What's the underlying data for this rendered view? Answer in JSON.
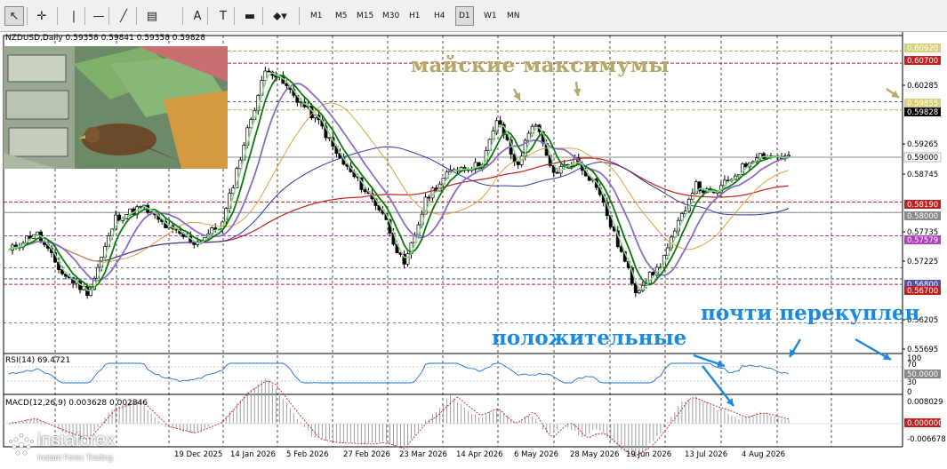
{
  "toolbar": {
    "tools": [
      {
        "name": "cursor-icon",
        "glyph": "↖",
        "active": true
      },
      {
        "name": "crosshair-icon",
        "glyph": "✛",
        "active": false
      },
      {
        "name": "vertical-line-icon",
        "glyph": "|",
        "active": false
      },
      {
        "name": "horizontal-line-icon",
        "glyph": "—",
        "active": false
      },
      {
        "name": "trendline-icon",
        "glyph": "╱",
        "active": false
      },
      {
        "name": "fibonacci-icon",
        "glyph": "▤",
        "active": false
      },
      {
        "name": "text-icon",
        "glyph": "A",
        "active": false
      },
      {
        "name": "label-icon",
        "glyph": "T",
        "active": false
      },
      {
        "name": "rectangle-icon",
        "glyph": "▬",
        "active": false
      },
      {
        "name": "shapes-dropdown-icon",
        "glyph": "⬥▾",
        "active": false
      }
    ],
    "timeframes": [
      "M1",
      "M5",
      "M15",
      "M30",
      "H1",
      "H4",
      "D1",
      "W1",
      "MN"
    ],
    "active_timeframe": "D1"
  },
  "chart": {
    "header": "NZDUSD,Daily  0.59358 0.59841 0.59358 0.59828",
    "price_levels": [
      "0.60920",
      "0.60700",
      "0.60285",
      "0.59855",
      "0.59828",
      "0.59265",
      "0.59000",
      "0.58745",
      "0.58190",
      "0.58000",
      "0.57735",
      "0.57579",
      "0.57225",
      "0.56800",
      "0.56700",
      "0.56205",
      "0.55695"
    ],
    "date_labels": [
      "19 Dec 2025",
      "14 Jan 2026",
      "5 Feb 2026",
      "27 Feb 2026",
      "23 Mar 2026",
      "14 Apr 2026",
      "6 May 2026",
      "28 May 2026",
      "19 Jun 2026",
      "13 Jul 2026",
      "4 Aug 2026"
    ],
    "annotations": {
      "may_highs": "майские максимумы",
      "positive": "положительные",
      "almost_overbought": "почти перекуплен"
    }
  },
  "rsi": {
    "label": "RSI(14) 69.4721",
    "levels": [
      "100",
      "70",
      "50.0000",
      "30",
      "0"
    ]
  },
  "macd": {
    "label": "MACD(12,26,9) 0.003628 0.002846",
    "levels": [
      "0.008029",
      "0.000000",
      "-0.006678"
    ]
  },
  "branding": {
    "logo_name": "instaforex",
    "logo_tagline": "Instant Forex Trading"
  },
  "colors": {
    "fast_ma": "#0a7a0a",
    "light_ma": "#90d890",
    "purple_ma": "#8c6cc4",
    "blue_ma": "#2a3aa0",
    "red_ma": "#c02020",
    "orange_ma": "#e0a040",
    "annotation_gold": "#b4a86a",
    "annotation_blue": "#1a8ae0"
  }
}
